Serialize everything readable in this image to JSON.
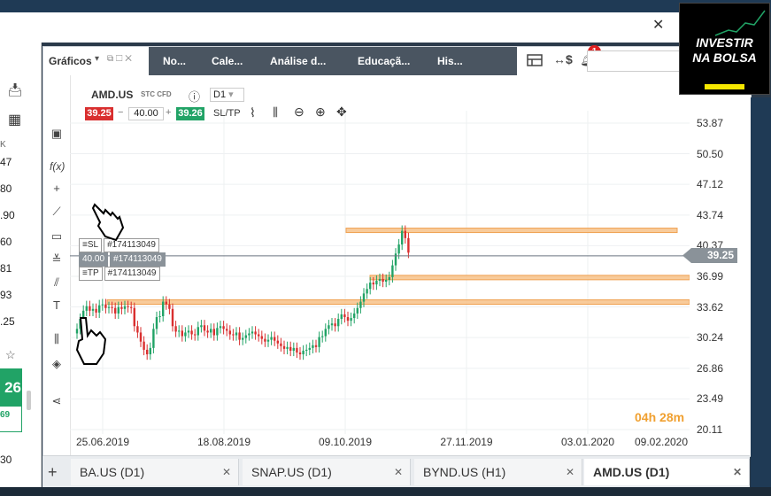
{
  "header": {
    "title": "Gráficos",
    "tabs": [
      "No...",
      "Cale...",
      "Análise d...",
      "Educaçã...",
      "His..."
    ],
    "notification_count": "1"
  },
  "left_panel": {
    "values": [
      "K",
      "47",
      "80",
      ".90",
      "60",
      "81",
      "93",
      ".25"
    ],
    "green_value": "26",
    "green_sub": "69",
    "bottom_value": "30"
  },
  "instrument": {
    "symbol": "AMD.US",
    "type": "STC CFD",
    "timeframe": "D1",
    "sell": "39.25",
    "volume": "40.00",
    "buy": "39.26",
    "sltp": "SL/TP"
  },
  "orders": {
    "sl_label": "SL",
    "sl_id": "#174113049",
    "entry_price": "40.00",
    "entry_id": "#174113049",
    "tp_label": "TP",
    "tp_id": "#174113049"
  },
  "countdown": {
    "hours": "04",
    "hours_unit": "h",
    "minutes": "28",
    "minutes_unit": "m"
  },
  "current_price": "39.25",
  "chart_data": {
    "type": "candlestick",
    "y_ticks": [
      "53.87",
      "50.50",
      "47.12",
      "43.74",
      "40.37",
      "36.99",
      "33.62",
      "30.24",
      "26.86",
      "23.49",
      "20.11"
    ],
    "x_ticks": [
      "25.06.2019",
      "18.08.2019",
      "09.10.2019",
      "27.11.2019",
      "03.01.2020",
      "09.02.2020"
    ],
    "ylim": [
      20.11,
      53.87
    ],
    "grid": true,
    "zones": [
      {
        "low": 41.9,
        "high": 42.3
      },
      {
        "low": 36.7,
        "high": 37.1
      },
      {
        "low": 34.0,
        "high": 34.4
      }
    ],
    "closes": [
      31.2,
      32.3,
      33.2,
      33.7,
      33.2,
      33.4,
      33.0,
      33.8,
      33.9,
      33.5,
      33.6,
      33.5,
      32.9,
      33.6,
      33.4,
      33.7,
      33.6,
      33.5,
      31.5,
      30.8,
      29.8,
      28.9,
      28.4,
      29.1,
      31.2,
      32.5,
      32.6,
      34.2,
      33.9,
      33.4,
      31.5,
      30.9,
      31.0,
      30.4,
      30.8,
      31.0,
      30.6,
      30.5,
      31.4,
      31.6,
      31.0,
      30.8,
      31.2,
      30.5,
      31.3,
      31.5,
      31.2,
      31.0,
      30.6,
      30.5,
      30.8,
      30.0,
      30.2,
      30.5,
      30.7,
      30.9,
      30.6,
      30.4,
      30.1,
      29.8,
      30.0,
      30.3,
      29.9,
      29.6,
      29.3,
      29.0,
      29.2,
      28.8,
      29.1,
      28.6,
      28.4,
      28.8,
      28.9,
      29.1,
      29.4,
      29.2,
      30.3,
      30.4,
      31.2,
      31.6,
      31.8,
      31.5,
      32.3,
      32.8,
      32.5,
      32.1,
      32.4,
      32.9,
      33.5,
      34.2,
      35.1,
      35.6,
      36.3,
      36.1,
      36.5,
      36.7,
      36.4,
      36.6,
      36.9,
      38.2,
      39.5,
      40.5,
      42.0,
      41.2,
      39.6
    ]
  }
}
